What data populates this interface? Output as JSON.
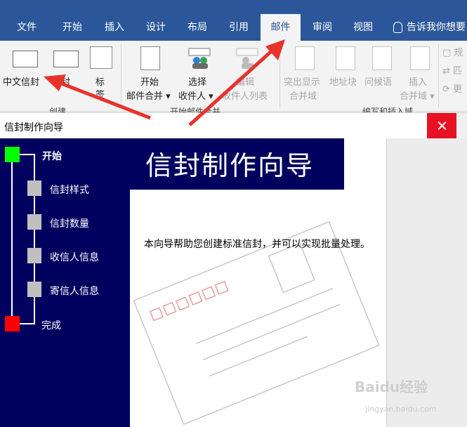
{
  "ribbon": {
    "tabs": [
      {
        "label": "文件",
        "active": false
      },
      {
        "label": "开始",
        "active": false
      },
      {
        "label": "插入",
        "active": false
      },
      {
        "label": "设计",
        "active": false
      },
      {
        "label": "布局",
        "active": false
      },
      {
        "label": "引用",
        "active": false
      },
      {
        "label": "邮件",
        "active": true
      },
      {
        "label": "审阅",
        "active": false
      },
      {
        "label": "视图",
        "active": false
      }
    ],
    "tell_me": "告诉我你想要",
    "buttons": {
      "chinese_envelope": "中文信封",
      "envelope": "信封",
      "labels_line1": "标",
      "labels_line2": "签",
      "start_merge_line1": "开始",
      "start_merge_line2": "邮件合并",
      "select_recipients_line1": "选择",
      "select_recipients_line2": "收件人",
      "edit_list_line1": "编辑",
      "edit_list_line2": "收件人列表",
      "highlight_line1": "突出显示",
      "highlight_line2": "合并域",
      "address_block": "地址块",
      "greeting_line": "问候语",
      "insert_field_line1": "插入",
      "insert_field_line2": "合并域",
      "rules_partial": "规",
      "match_partial": "匹",
      "update_partial": "更"
    },
    "groups": {
      "create": "创建",
      "start_merge": "开始邮件合并",
      "write_insert": "编写和插入域"
    }
  },
  "dialog": {
    "title": "信封制作向导",
    "banner": "信封制作向导",
    "steps": [
      {
        "label": "开始",
        "state": "current",
        "color": "#00ff00"
      },
      {
        "label": "信封样式",
        "state": "pending",
        "color": "#c0c0c0"
      },
      {
        "label": "信封数量",
        "state": "pending",
        "color": "#c0c0c0"
      },
      {
        "label": "收信人信息",
        "state": "pending",
        "color": "#c0c0c0"
      },
      {
        "label": "寄信人信息",
        "state": "pending",
        "color": "#c0c0c0"
      },
      {
        "label": "完成",
        "state": "end",
        "color": "#ff0000"
      }
    ],
    "intro_text": "本向导帮助您创建标准信封，并可以实现批量处理。"
  },
  "watermark": {
    "brand": "Baidu经验",
    "url": "jingyan.baidu.com"
  },
  "colors": {
    "ribbon_blue": "#2b579a",
    "nav_navy": "#00005e",
    "close_red": "#e81123",
    "arrow_red": "#e8322c"
  }
}
